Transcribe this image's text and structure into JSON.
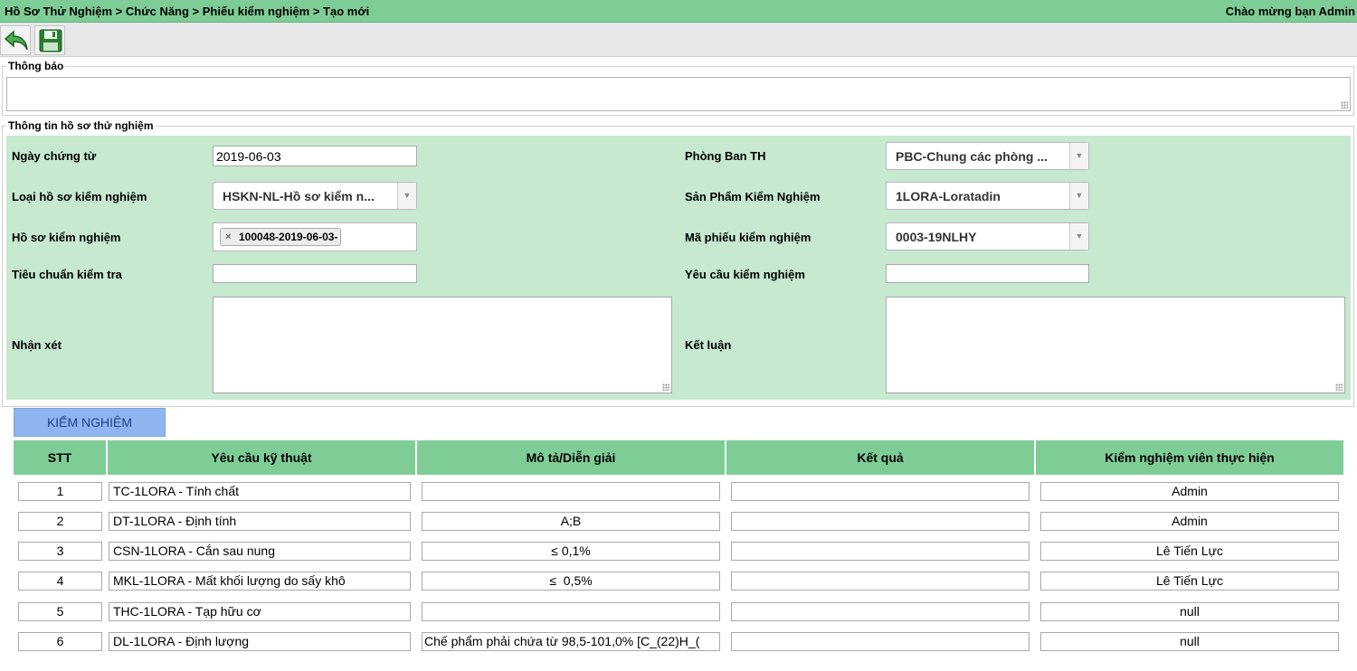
{
  "header": {
    "breadcrumb": "Hồ Sơ Thử Nghiệm > Chức Năng > Phiếu kiểm nghiệm > Tạo mới",
    "welcome": "Chào mừng bạn Admin"
  },
  "toolbar": {
    "back_icon": "back-arrow-icon",
    "save_icon": "floppy-save-icon"
  },
  "notice": {
    "legend": "Thông báo",
    "value": ""
  },
  "form": {
    "legend": "Thông tin hồ sơ thử nghiệm",
    "ngay_chung_tu": {
      "label": "Ngày chứng từ",
      "value": "2019-06-03"
    },
    "phong_ban": {
      "label": "Phòng Ban TH",
      "value": "PBC-Chung các phòng ..."
    },
    "loai_ho_so": {
      "label": "Loại hồ sơ kiểm nghiệm",
      "value": "HSKN-NL-Hồ sơ kiểm n..."
    },
    "san_pham": {
      "label": "Sản Phẩm Kiểm Nghiệm",
      "value": "1LORA-Loratadin"
    },
    "ho_so": {
      "label": "Hồ sơ kiểm nghiệm",
      "chip": "100048-2019-06-03-",
      "chip_remove": "×"
    },
    "ma_phieu": {
      "label": "Mã phiếu kiểm nghiệm",
      "value": "0003-19NLHY"
    },
    "tieu_chuan": {
      "label": "Tiêu chuẩn kiểm tra",
      "value": ""
    },
    "yeu_cau": {
      "label": "Yêu cầu kiểm nghiệm",
      "value": ""
    },
    "nhan_xet": {
      "label": "Nhận xét",
      "value": ""
    },
    "ket_luan": {
      "label": "Kết luận",
      "value": ""
    },
    "dropdown_arrow": "▼"
  },
  "tab": {
    "label": "KIỂM NGHIỆM"
  },
  "table": {
    "headers": [
      "STT",
      "Yêu cầu kỹ thuật",
      "Mô tả/Diễn giải",
      "Kết quả",
      "Kiểm nghiệm viên thực hiện"
    ],
    "rows": [
      {
        "stt": "1",
        "yeu_cau": "TC-1LORA - Tính chất",
        "mo_ta": "",
        "ket_qua": "",
        "kiem_nghiem_vien": "Admin"
      },
      {
        "stt": "2",
        "yeu_cau": "DT-1LORA - Định tính",
        "mo_ta": "A;B",
        "ket_qua": "",
        "kiem_nghiem_vien": "Admin"
      },
      {
        "stt": "3",
        "yeu_cau": "CSN-1LORA - Cắn sau nung",
        "mo_ta": "≤ 0,1%",
        "ket_qua": "",
        "kiem_nghiem_vien": "Lê Tiến Lực"
      },
      {
        "stt": "4",
        "yeu_cau": "MKL-1LORA - Mất khối lượng do sấy khô",
        "mo_ta": "≤  0,5%",
        "ket_qua": "",
        "kiem_nghiem_vien": "Lê Tiến Lực"
      },
      {
        "stt": "5",
        "yeu_cau": "THC-1LORA - Tạp hữu cơ",
        "mo_ta": "",
        "ket_qua": "",
        "kiem_nghiem_vien": "null"
      },
      {
        "stt": "6",
        "yeu_cau": "DL-1LORA - Định lượng",
        "mo_ta": "Chế phẩm phải chứa từ 98,5-101,0% [C_(22)H_(",
        "ket_qua": "",
        "kiem_nghiem_vien": "null"
      }
    ]
  }
}
